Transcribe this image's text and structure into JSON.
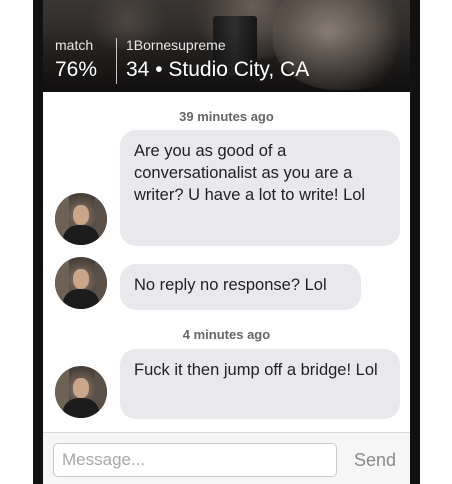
{
  "header": {
    "match_label": "match",
    "match_value": "76%",
    "username": "1Bornesupreme",
    "user_info": "34 • Studio City, CA"
  },
  "chat": {
    "timestamps": [
      "39 minutes ago",
      "4 minutes ago"
    ],
    "messages": [
      "Are you as good of a conversationalist as you are a writer? U have a lot to write! Lol",
      "No reply no response? Lol",
      "Fuck it then jump off a bridge! Lol"
    ]
  },
  "composer": {
    "placeholder": "Message...",
    "send_label": "Send"
  }
}
